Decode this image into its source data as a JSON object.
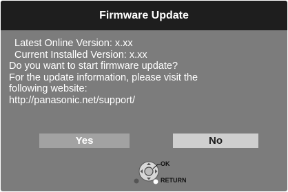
{
  "dialog": {
    "title": "Firmware Update",
    "lines": [
      "Latest Online Version: x.xx",
      "Current Installed Version: x.xx",
      "Do you want to start firmware update?",
      "For the update information, please visit the",
      "following website:",
      "http://panasonic.net/support/"
    ],
    "buttons": {
      "yes": "Yes",
      "no": "No"
    },
    "hints": {
      "ok": "OK",
      "return": "RETURN"
    }
  },
  "colors": {
    "dialog_background": "#7c7c7c",
    "title_bar": "#1e1e1e",
    "yes_button": "#a2a2a2",
    "no_button": "#cfcfcf"
  },
  "icons": [
    "dpad-ok-icon",
    "return-button-icon"
  ]
}
